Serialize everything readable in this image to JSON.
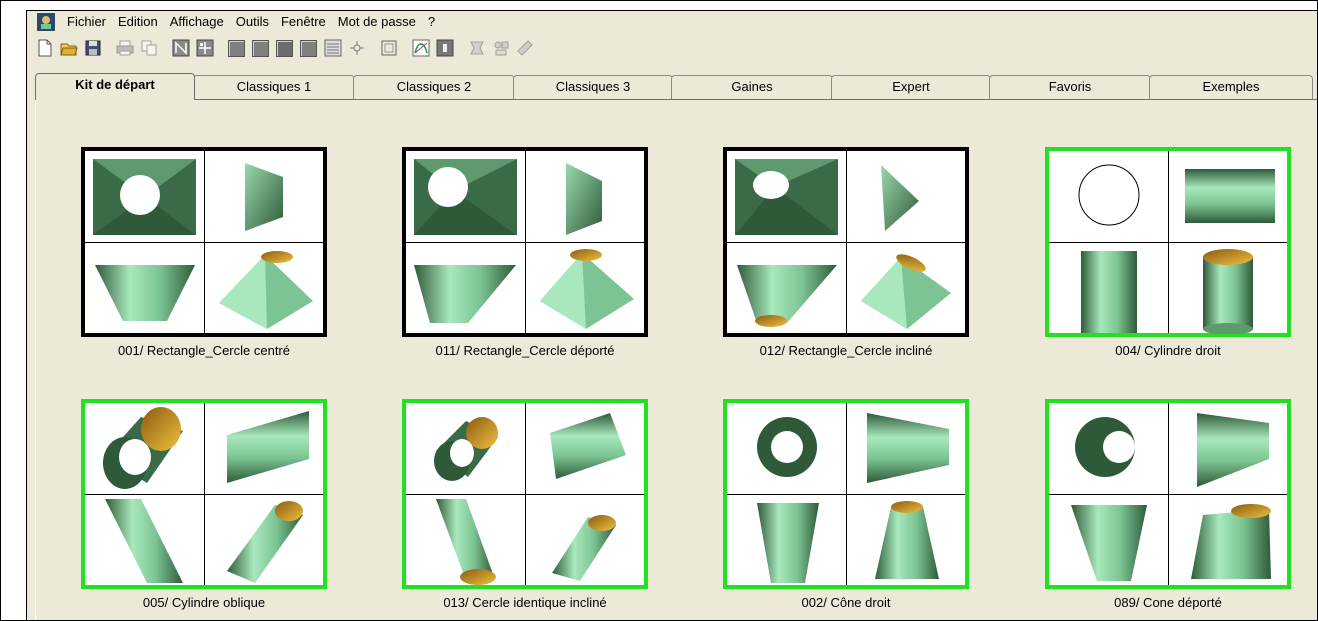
{
  "menu": {
    "items": [
      "Fichier",
      "Edition",
      "Affichage",
      "Outils",
      "Fenêtre",
      "Mot de passe",
      "?"
    ]
  },
  "toolbar": {
    "buttons": [
      "new-icon",
      "open-icon",
      "save-icon",
      "print-icon",
      "copy-icon",
      "view-grid-icon",
      "view-split-icon",
      "square1-icon",
      "square2-icon",
      "square3-icon",
      "square4-icon",
      "layers-icon",
      "cluster-icon",
      "frame-icon",
      "curve-icon",
      "panel-icon",
      "shape2d-icon",
      "shape-ab-icon",
      "shape3d-icon"
    ]
  },
  "tabs": [
    "Kit de départ",
    "Classiques 1",
    "Classiques 2",
    "Classiques 3",
    "Gaines",
    "Expert",
    "Favoris",
    "Exemples"
  ],
  "active_tab": "Kit de départ",
  "colors": {
    "highlight_border": "#22e022",
    "default_border": "#000000",
    "shape_fill": "#7cc493",
    "shape_dark": "#2f5a3a",
    "inner_gold": "#d8a830"
  },
  "kits": [
    {
      "label": "001/ Rectangle_Cercle centré",
      "frame": "black"
    },
    {
      "label": "011/ Rectangle_Cercle déporté",
      "frame": "black"
    },
    {
      "label": "012/ Rectangle_Cercle incliné",
      "frame": "black"
    },
    {
      "label": "004/ Cylindre droit",
      "frame": "green"
    },
    {
      "label": "005/ Cylindre oblique",
      "frame": "green"
    },
    {
      "label": "013/ Cercle identique incliné",
      "frame": "green"
    },
    {
      "label": "002/ Cône droit",
      "frame": "green"
    },
    {
      "label": "089/ Cone déporté",
      "frame": "green"
    }
  ]
}
